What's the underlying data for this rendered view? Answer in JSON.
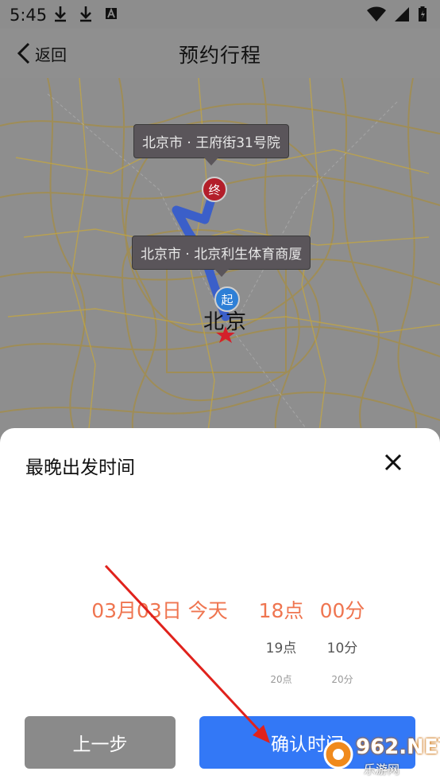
{
  "status_bar": {
    "time": "5:45",
    "icons_left": [
      "download-icon",
      "download-icon",
      "font-a-icon"
    ],
    "icons_right": [
      "wifi-icon",
      "signal-icon",
      "battery-icon"
    ]
  },
  "header": {
    "back_label": "返回",
    "title": "预约行程"
  },
  "map": {
    "end_callout": "北京市 · 王府街31号院",
    "start_callout": "北京市 · 北京利生体育商厦",
    "end_marker": "终",
    "start_marker": "起",
    "city_label": "北京",
    "colors": {
      "route": "#3b5fc9",
      "end_marker": "#b31e2a",
      "start_marker": "#2e7fd6",
      "star": "#d4202a"
    }
  },
  "sheet": {
    "title": "最晚出发时间",
    "picker": {
      "date": {
        "selected": "03月03日 今天"
      },
      "hour": {
        "selected": "18点",
        "next": [
          "19点",
          "20点"
        ]
      },
      "minute": {
        "selected": "00分",
        "next": [
          "10分",
          "20分"
        ]
      }
    },
    "buttons": {
      "prev": "上一步",
      "confirm": "确认时间"
    },
    "colors": {
      "accent": "#ef7550",
      "confirm_button": "#3378f6",
      "prev_button": "#8a8a8a"
    }
  },
  "watermark": {
    "text": "962.NET",
    "sub": "乐游网"
  }
}
